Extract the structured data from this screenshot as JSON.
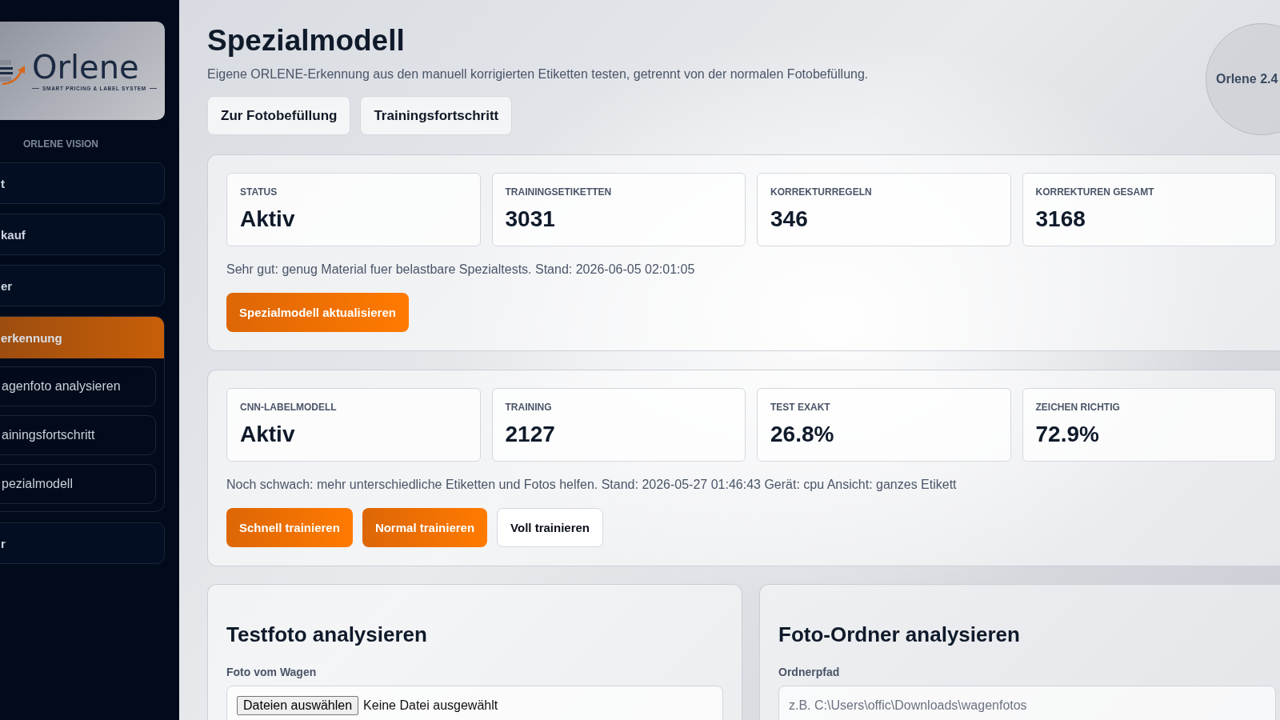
{
  "sidebar": {
    "logo": {
      "wordmark": "Orlene",
      "tagline": "SMART PRICING & LABEL SYSTEM"
    },
    "section_label": "ORLENE VISION",
    "items": [
      {
        "label": "t",
        "selected": false,
        "expanded": false
      },
      {
        "label": "kauf",
        "selected": false,
        "expanded": false
      },
      {
        "label": "er",
        "selected": false,
        "expanded": false
      },
      {
        "label": "erkennung",
        "selected": true,
        "expanded": true,
        "children": [
          {
            "label": "agenfoto analysieren",
            "selected": false
          },
          {
            "label": "ainingsfortschritt",
            "selected": false
          },
          {
            "label": "pezialmodell",
            "selected": false
          }
        ]
      },
      {
        "label": "r",
        "selected": false,
        "expanded": false
      }
    ]
  },
  "header": {
    "title": "Spezialmodell",
    "subtitle": "Eigene ORLENE-Erkennung aus den manuell korrigierten Etiketten testen, getrennt von der normalen Fotobefüllung.",
    "buttons": [
      "Zur Fotobefüllung",
      "Trainingsfortschritt"
    ],
    "version_badge": "Orlene 2.4"
  },
  "panels": [
    {
      "stats": [
        {
          "label": "STATUS",
          "value": "Aktiv"
        },
        {
          "label": "TRAININGSETIKETTEN",
          "value": "3031"
        },
        {
          "label": "KORREKTURREGELN",
          "value": "346"
        },
        {
          "label": "KORREKTUREN GESAMT",
          "value": "3168"
        }
      ],
      "status_text": "Sehr gut: genug Material fuer belastbare Spezialtests. Stand: 2026-06-05 02:01:05",
      "buttons": [
        {
          "label": "Spezialmodell aktualisieren",
          "kind": "primary"
        }
      ]
    },
    {
      "stats": [
        {
          "label": "CNN-LABELMODELL",
          "value": "Aktiv"
        },
        {
          "label": "TRAINING",
          "value": "2127"
        },
        {
          "label": "TEST EXAKT",
          "value": "26.8%"
        },
        {
          "label": "ZEICHEN RICHTIG",
          "value": "72.9%"
        }
      ],
      "status_text": "Noch schwach: mehr unterschiedliche Etiketten und Fotos helfen. Stand: 2026-05-27 01:46:43 Gerät: cpu Ansicht: ganzes Etikett",
      "buttons": [
        {
          "label": "Schnell trainieren",
          "kind": "primary"
        },
        {
          "label": "Normal trainieren",
          "kind": "primary"
        },
        {
          "label": "Voll trainieren",
          "kind": "secondary"
        }
      ]
    }
  ],
  "sections": [
    {
      "title": "Testfoto analysieren",
      "field_label": "Foto vom Wagen",
      "kind": "file",
      "button": "Dateien auswählen",
      "value": "Keine Datei ausgewählt"
    },
    {
      "title": "Foto-Ordner analysieren",
      "field_label": "Ordnerpfad",
      "kind": "text",
      "placeholder": "z.B. C:\\Users\\offic\\Downloads\\wagenfotos"
    }
  ]
}
